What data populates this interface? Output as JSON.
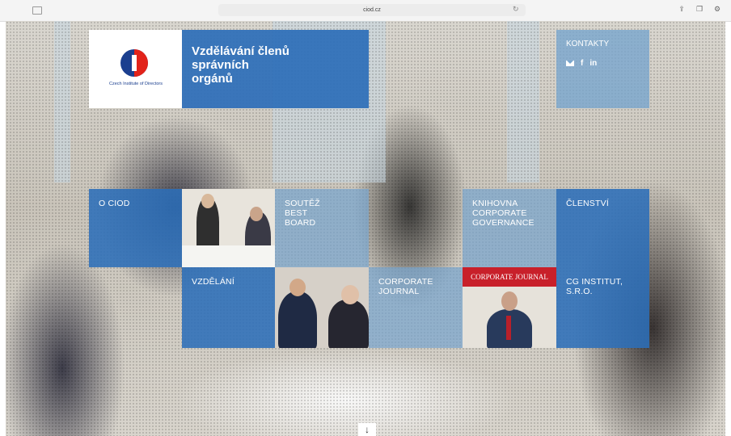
{
  "browser": {
    "url": "ciod.cz"
  },
  "logo": {
    "text": "Czech Institute of Directors"
  },
  "header": {
    "title": "Vzdělávání členů\nsprávních\norgánů"
  },
  "contacts": {
    "label": "KONTAKTY",
    "linkedin": "in",
    "facebook": "f"
  },
  "tiles": {
    "o_ciod": "O CIOD",
    "soutez": "SOUTĚŽ\nBEST\nBOARD",
    "knihovna": "KNIHOVNA\nCORPORATE\nGOVERNANCE",
    "clenstvi": "ČLENSTVÍ",
    "vzdelani": "VZDĚLÁNÍ",
    "corporate_journal": "CORPORATE\nJOURNAL",
    "cg_institut": "CG INSTITUT,\nS.R.O."
  },
  "journal_cover": {
    "masthead": "CORPORATE JOURNAL"
  },
  "colors": {
    "tile_dark": "#2c6eb8",
    "tile_light": "#78a5cd",
    "brand_red": "#e2231a",
    "brand_blue": "#1b3f8f"
  },
  "icons": {
    "scroll": "arrow-down-icon"
  }
}
